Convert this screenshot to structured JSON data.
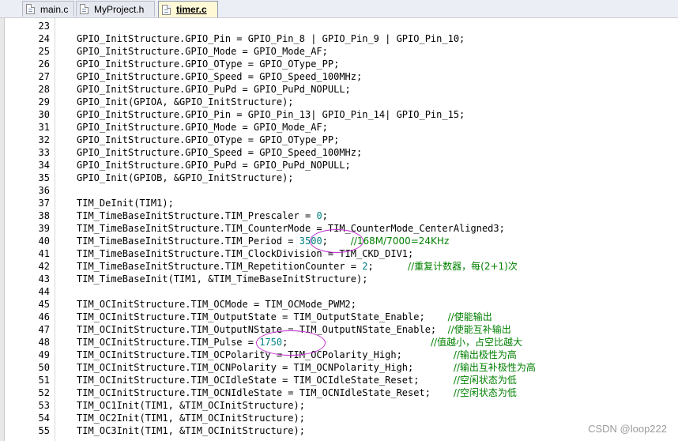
{
  "tabs": [
    {
      "label": "main.c",
      "active": false
    },
    {
      "label": "MyProject.h",
      "active": false
    },
    {
      "label": "timer.c",
      "active": true
    }
  ],
  "lines": [
    {
      "no": "23",
      "code": "",
      "comment": ""
    },
    {
      "no": "24",
      "code": "GPIO_InitStructure.GPIO_Pin = GPIO_Pin_8 | GPIO_Pin_9 | GPIO_Pin_10;",
      "comment": ""
    },
    {
      "no": "25",
      "code": "GPIO_InitStructure.GPIO_Mode = GPIO_Mode_AF;",
      "comment": ""
    },
    {
      "no": "26",
      "code": "GPIO_InitStructure.GPIO_OType = GPIO_OType_PP;",
      "comment": ""
    },
    {
      "no": "27",
      "code": "GPIO_InitStructure.GPIO_Speed = GPIO_Speed_100MHz;",
      "comment": ""
    },
    {
      "no": "28",
      "code": "GPIO_InitStructure.GPIO_PuPd = GPIO_PuPd_NOPULL;",
      "comment": ""
    },
    {
      "no": "29",
      "code": "GPIO_Init(GPIOA, &GPIO_InitStructure);",
      "comment": ""
    },
    {
      "no": "30",
      "code": "GPIO_InitStructure.GPIO_Pin = GPIO_Pin_13| GPIO_Pin_14| GPIO_Pin_15;",
      "comment": ""
    },
    {
      "no": "31",
      "code": "GPIO_InitStructure.GPIO_Mode = GPIO_Mode_AF;",
      "comment": ""
    },
    {
      "no": "32",
      "code": "GPIO_InitStructure.GPIO_OType = GPIO_OType_PP;",
      "comment": ""
    },
    {
      "no": "33",
      "code": "GPIO_InitStructure.GPIO_Speed = GPIO_Speed_100MHz;",
      "comment": ""
    },
    {
      "no": "34",
      "code": "GPIO_InitStructure.GPIO_PuPd = GPIO_PuPd_NOPULL;",
      "comment": ""
    },
    {
      "no": "35",
      "code": "GPIO_Init(GPIOB, &GPIO_InitStructure);",
      "comment": ""
    },
    {
      "no": "36",
      "code": "",
      "comment": ""
    },
    {
      "no": "37",
      "code": "TIM_DeInit(TIM1);",
      "comment": ""
    },
    {
      "no": "38",
      "code": "TIM_TimeBaseInitStructure.TIM_Prescaler = ",
      "num": "0",
      "tail": ";",
      "comment": ""
    },
    {
      "no": "39",
      "code": "TIM_TimeBaseInitStructure.TIM_CounterMode = TIM_CounterMode_CenterAligned3;",
      "comment": ""
    },
    {
      "no": "40",
      "code": "TIM_TimeBaseInitStructure.TIM_Period = ",
      "num": "3500",
      "tail": ";    ",
      "comment": "//168M/7000=24KHz"
    },
    {
      "no": "41",
      "code": "TIM_TimeBaseInitStructure.TIM_ClockDivision = TIM_CKD_DIV1;",
      "comment": ""
    },
    {
      "no": "42",
      "code": "TIM_TimeBaseInitStructure.TIM_RepetitionCounter = ",
      "num": "2",
      "tail": ";      ",
      "comment": "//重复计数器，每(2+1)次"
    },
    {
      "no": "43",
      "code": "TIM_TimeBaseInit(TIM1, &TIM_TimeBaseInitStructure);",
      "comment": ""
    },
    {
      "no": "44",
      "code": "",
      "comment": ""
    },
    {
      "no": "45",
      "code": "TIM_OCInitStructure.TIM_OCMode = TIM_OCMode_PWM2;",
      "comment": ""
    },
    {
      "no": "46",
      "code": "TIM_OCInitStructure.TIM_OutputState = TIM_OutputState_Enable;    ",
      "comment": "//使能输出"
    },
    {
      "no": "47",
      "code": "TIM_OCInitStructure.TIM_OutputNState = TIM_OutputNState_Enable;  ",
      "comment": "//使能互补输出"
    },
    {
      "no": "48",
      "code": "TIM_OCInitStructure.TIM_Pulse = ",
      "num": "1750",
      "tail": ";                         ",
      "comment": "//值越小，占空比越大"
    },
    {
      "no": "49",
      "code": "TIM_OCInitStructure.TIM_OCPolarity = TIM_OCPolarity_High;         ",
      "comment": "//输出极性为高"
    },
    {
      "no": "50",
      "code": "TIM_OCInitStructure.TIM_OCNPolarity = TIM_OCNPolarity_High;       ",
      "comment": "//输出互补极性为高"
    },
    {
      "no": "51",
      "code": "TIM_OCInitStructure.TIM_OCIdleState = TIM_OCIdleState_Reset;      ",
      "comment": "//空闲状态为低"
    },
    {
      "no": "52",
      "code": "TIM_OCInitStructure.TIM_OCNIdleState = TIM_OCNIdleState_Reset;    ",
      "comment": "//空闲状态为低"
    },
    {
      "no": "53",
      "code": "TIM_OC1Init(TIM1, &TIM_OCInitStructure);",
      "comment": ""
    },
    {
      "no": "54",
      "code": "TIM_OC2Init(TIM1, &TIM_OCInitStructure);",
      "comment": ""
    },
    {
      "no": "55",
      "code": "TIM_OC3Init(TIM1, &TIM_OCInitStructure);",
      "comment": ""
    }
  ],
  "watermark": "CSDN @loop222",
  "colors": {
    "number": "#008080",
    "comment": "#008000",
    "annotation": "#c030d0",
    "active_tab": "#fff9d6"
  }
}
